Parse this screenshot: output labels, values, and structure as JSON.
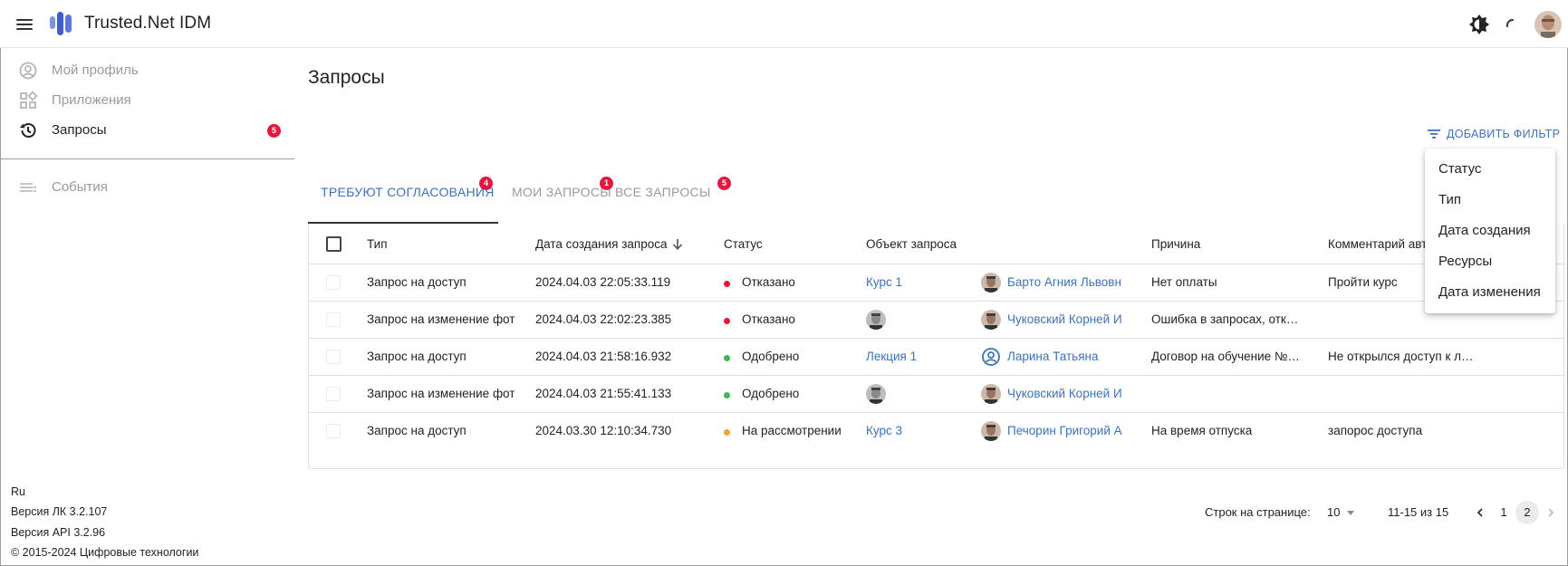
{
  "app": {
    "title": "Trusted.Net IDM"
  },
  "header": {
    "icons": [
      "menu-icon",
      "logo",
      "theme-toggle-icon",
      "loading-spinner-icon",
      "user-avatar"
    ]
  },
  "sidebar": {
    "items": [
      {
        "label": "Мой профиль",
        "icon": "account-circle-icon",
        "active": false
      },
      {
        "label": "Приложения",
        "icon": "apps-grid-icon",
        "active": false
      },
      {
        "label": "Запросы",
        "icon": "history-icon",
        "active": true,
        "badge": "5"
      },
      {
        "label": "События",
        "icon": "list-icon",
        "active": false
      }
    ],
    "footer": {
      "language": "Ru",
      "lk_version": "Версия ЛК 3.2.107",
      "api_version": "Версия API 3.2.96",
      "copyright": "© 2015-2024 Цифровые технологии"
    }
  },
  "main": {
    "title": "Запросы",
    "add_filter_label": "ДОБАВИТЬ ФИЛЬТР",
    "tabs": [
      {
        "label": "ТРЕБУЮТ СОГЛАСОВАНИЯ",
        "badge": "4",
        "active": true
      },
      {
        "label": "МОИ ЗАПРОСЫ",
        "badge": "1",
        "active": false
      },
      {
        "label": "ВСЕ ЗАПРОСЫ",
        "badge": "5",
        "active": false
      }
    ],
    "table": {
      "columns": [
        "Тип",
        "Дата создания запроса",
        "Статус",
        "Объект запроса",
        "Причина",
        "Комментарий авт"
      ],
      "sort_column": "Дата создания запроса",
      "rows": [
        {
          "type": "Запрос на доступ",
          "date": "2024.04.03 22:05:33.119",
          "status": "Отказано",
          "status_color": "#e5173f",
          "object": "Курс 1",
          "object_avatar": false,
          "user": "Барто Агния Львовн",
          "user_avatar": "photo",
          "reason": "Нет оплаты",
          "comment": "Пройти курс"
        },
        {
          "type": "Запрос на изменение фот",
          "date": "2024.04.03 22:02:23.385",
          "status": "Отказано",
          "status_color": "#e5173f",
          "object": "",
          "object_avatar": true,
          "user": "Чуковский Корней И",
          "user_avatar": "photo",
          "reason": "Ошибка в запросах, отк…",
          "comment": ""
        },
        {
          "type": "Запрос на доступ",
          "date": "2024.04.03 21:58:16.932",
          "status": "Одобрено",
          "status_color": "#3cb850",
          "object": "Лекция 1",
          "object_avatar": false,
          "user": "Ларина Татьяна",
          "user_avatar": "icon",
          "reason": "Договор на обучение №…",
          "comment": "Не открылся доступ к л…"
        },
        {
          "type": "Запрос на изменение фот",
          "date": "2024.04.03 21:55:41.133",
          "status": "Одобрено",
          "status_color": "#3cb850",
          "object": "",
          "object_avatar": true,
          "user": "Чуковский Корней И",
          "user_avatar": "photo",
          "reason": "",
          "comment": ""
        },
        {
          "type": "Запрос на доступ",
          "date": "2024.03.30 12:10:34.730",
          "status": "На рассмотрении",
          "status_color": "#f0a13b",
          "object": "Курс 3",
          "object_avatar": false,
          "user": "Печорин Григорий А",
          "user_avatar": "photo",
          "reason": "На время отпуска",
          "comment": "запорос доступа"
        }
      ]
    },
    "filter_menu": [
      "Статус",
      "Тип",
      "Дата создания",
      "Ресурсы",
      "Дата изменения"
    ],
    "pagination": {
      "rows_per_page_label": "Строк на странице:",
      "rows_per_page": "10",
      "range": "11-15 из 15",
      "pages": [
        "1",
        "2"
      ],
      "current_page": "2"
    }
  }
}
